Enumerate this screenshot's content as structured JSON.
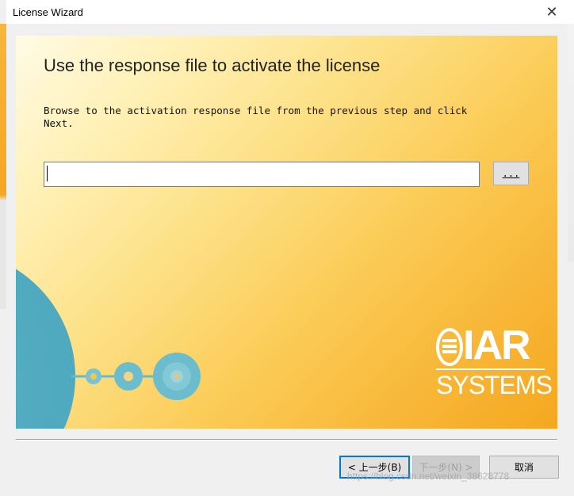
{
  "window": {
    "title": "License Wizard",
    "close_glyph": "✕"
  },
  "page": {
    "heading": "Use the response file to activate the license",
    "description": "Browse to the activation response file from the previous step and click\nNext.",
    "file_input_value": "",
    "browse_label": "..."
  },
  "logo": {
    "top": "IAR",
    "bottom": "SYSTEMS"
  },
  "buttons": {
    "back": "< 上一步(B)",
    "next": "下一步(N) >",
    "cancel": "取消"
  },
  "watermark": "https://blog.csdn.net/weixin_38628778",
  "colors": {
    "panel_light": "#fffbe6",
    "panel_dark": "#f5a81f",
    "decor": "#5ab4c8",
    "focus_border": "#0078d7"
  }
}
